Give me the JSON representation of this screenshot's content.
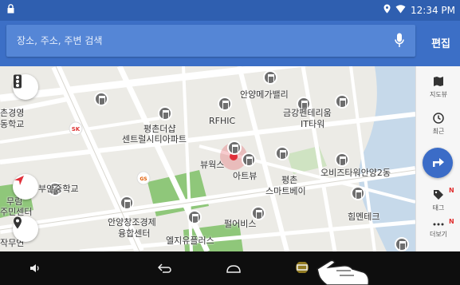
{
  "status_bar": {
    "time": "12:34 PM"
  },
  "search": {
    "placeholder": "장소, 주소, 주변 검색",
    "edit_label": "편집"
  },
  "map": {
    "labels": {
      "annyeong_megavalley": "안양메가밸리",
      "geumgang_penterium": "금강펜테리움",
      "it_tower": "IT타워",
      "pyeongchon_the_sharp_1": "평촌더샵",
      "pyeongchon_the_sharp_2": "센트럴시티아파트",
      "rfhic": "RFHIC",
      "viewworks": "뷰웍스",
      "art_view": "아트뷰",
      "smart_bay_1": "평촌",
      "smart_bay_2": "스마트베이",
      "obis_tower": "오비즈타워안양2동",
      "buan_middle_school": "부안중학교",
      "anyang_economy_1": "안양창조경제",
      "anyang_economy_2": "융합센터",
      "pearl_bis": "펄어비스",
      "lg_plus_1": "엘지유플러스",
      "him_tech": "힘멘테크",
      "left_top_1": "촌경영",
      "left_top_2": "동학교",
      "left_mid_1": "무림",
      "left_mid_2": "주민센터",
      "left_bottom": "작무연"
    }
  },
  "side_panel": {
    "map_view": "지도뷰",
    "recent": "최근",
    "tag": "태그",
    "more": "더보기",
    "new_badge": "N"
  },
  "colors": {
    "status_bar": "#2f5fb0",
    "header": "#3c6fc6",
    "accent": "#3b6cc7",
    "marker": "#e0303a",
    "park": "#8fc77a"
  }
}
